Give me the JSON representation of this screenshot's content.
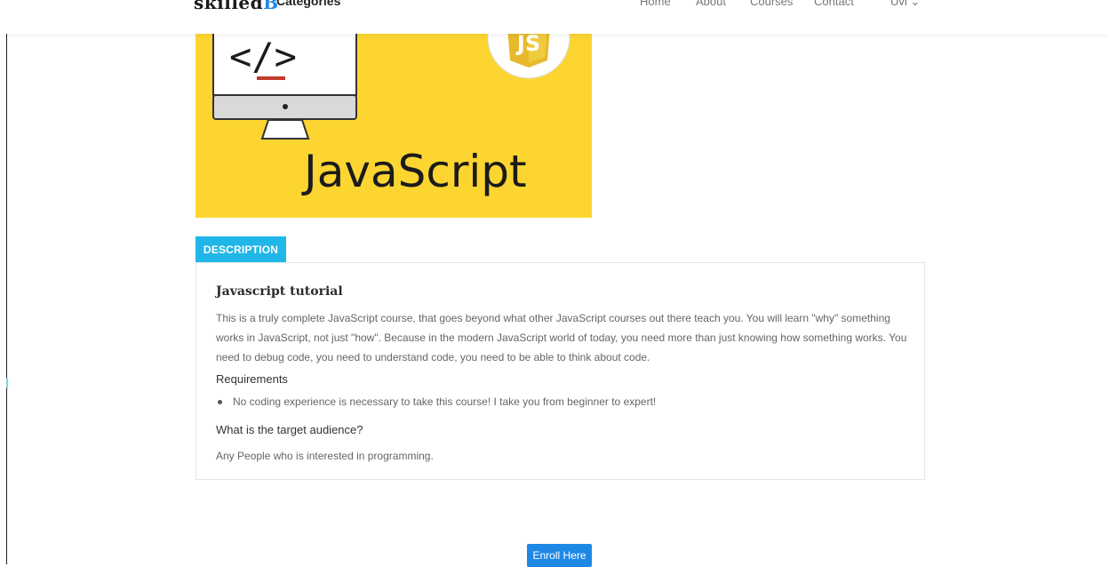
{
  "navbar": {
    "brand_main": "skilled",
    "brand_accent": "B",
    "categories_label": "Categories",
    "links": [
      "Home",
      "About",
      "Courses",
      "Contact"
    ],
    "user_label": "Uvi",
    "user_caret": "⌄"
  },
  "banner": {
    "code_text": "</>",
    "js_badge": "JS",
    "title": "JavaScript",
    "background_color": "#fcd531"
  },
  "description": {
    "tab_label": "DESCRIPTION",
    "course_title": "Javascript tutorial",
    "course_text": "This is a truly complete JavaScript course, that goes beyond what other JavaScript courses out there teach you. You will learn \"why\" something works in JavaScript, not just \"how\". Because in the modern JavaScript world of today, you need more than just knowing how something works. You need to debug code, you need to understand code, you need to be able to think about code.",
    "requirements_heading": "Requirements",
    "requirements": [
      "No coding experience is necessary to take this course! I take you from beginner to expert!"
    ],
    "audience_heading": "What is the target audience?",
    "audience_text": "Any People who is interested in programming."
  },
  "enroll": {
    "label": "Enroll Here",
    "color": "#1e88e5"
  },
  "colors": {
    "tab": "#21b6e8",
    "accent": "#1e88e5"
  }
}
